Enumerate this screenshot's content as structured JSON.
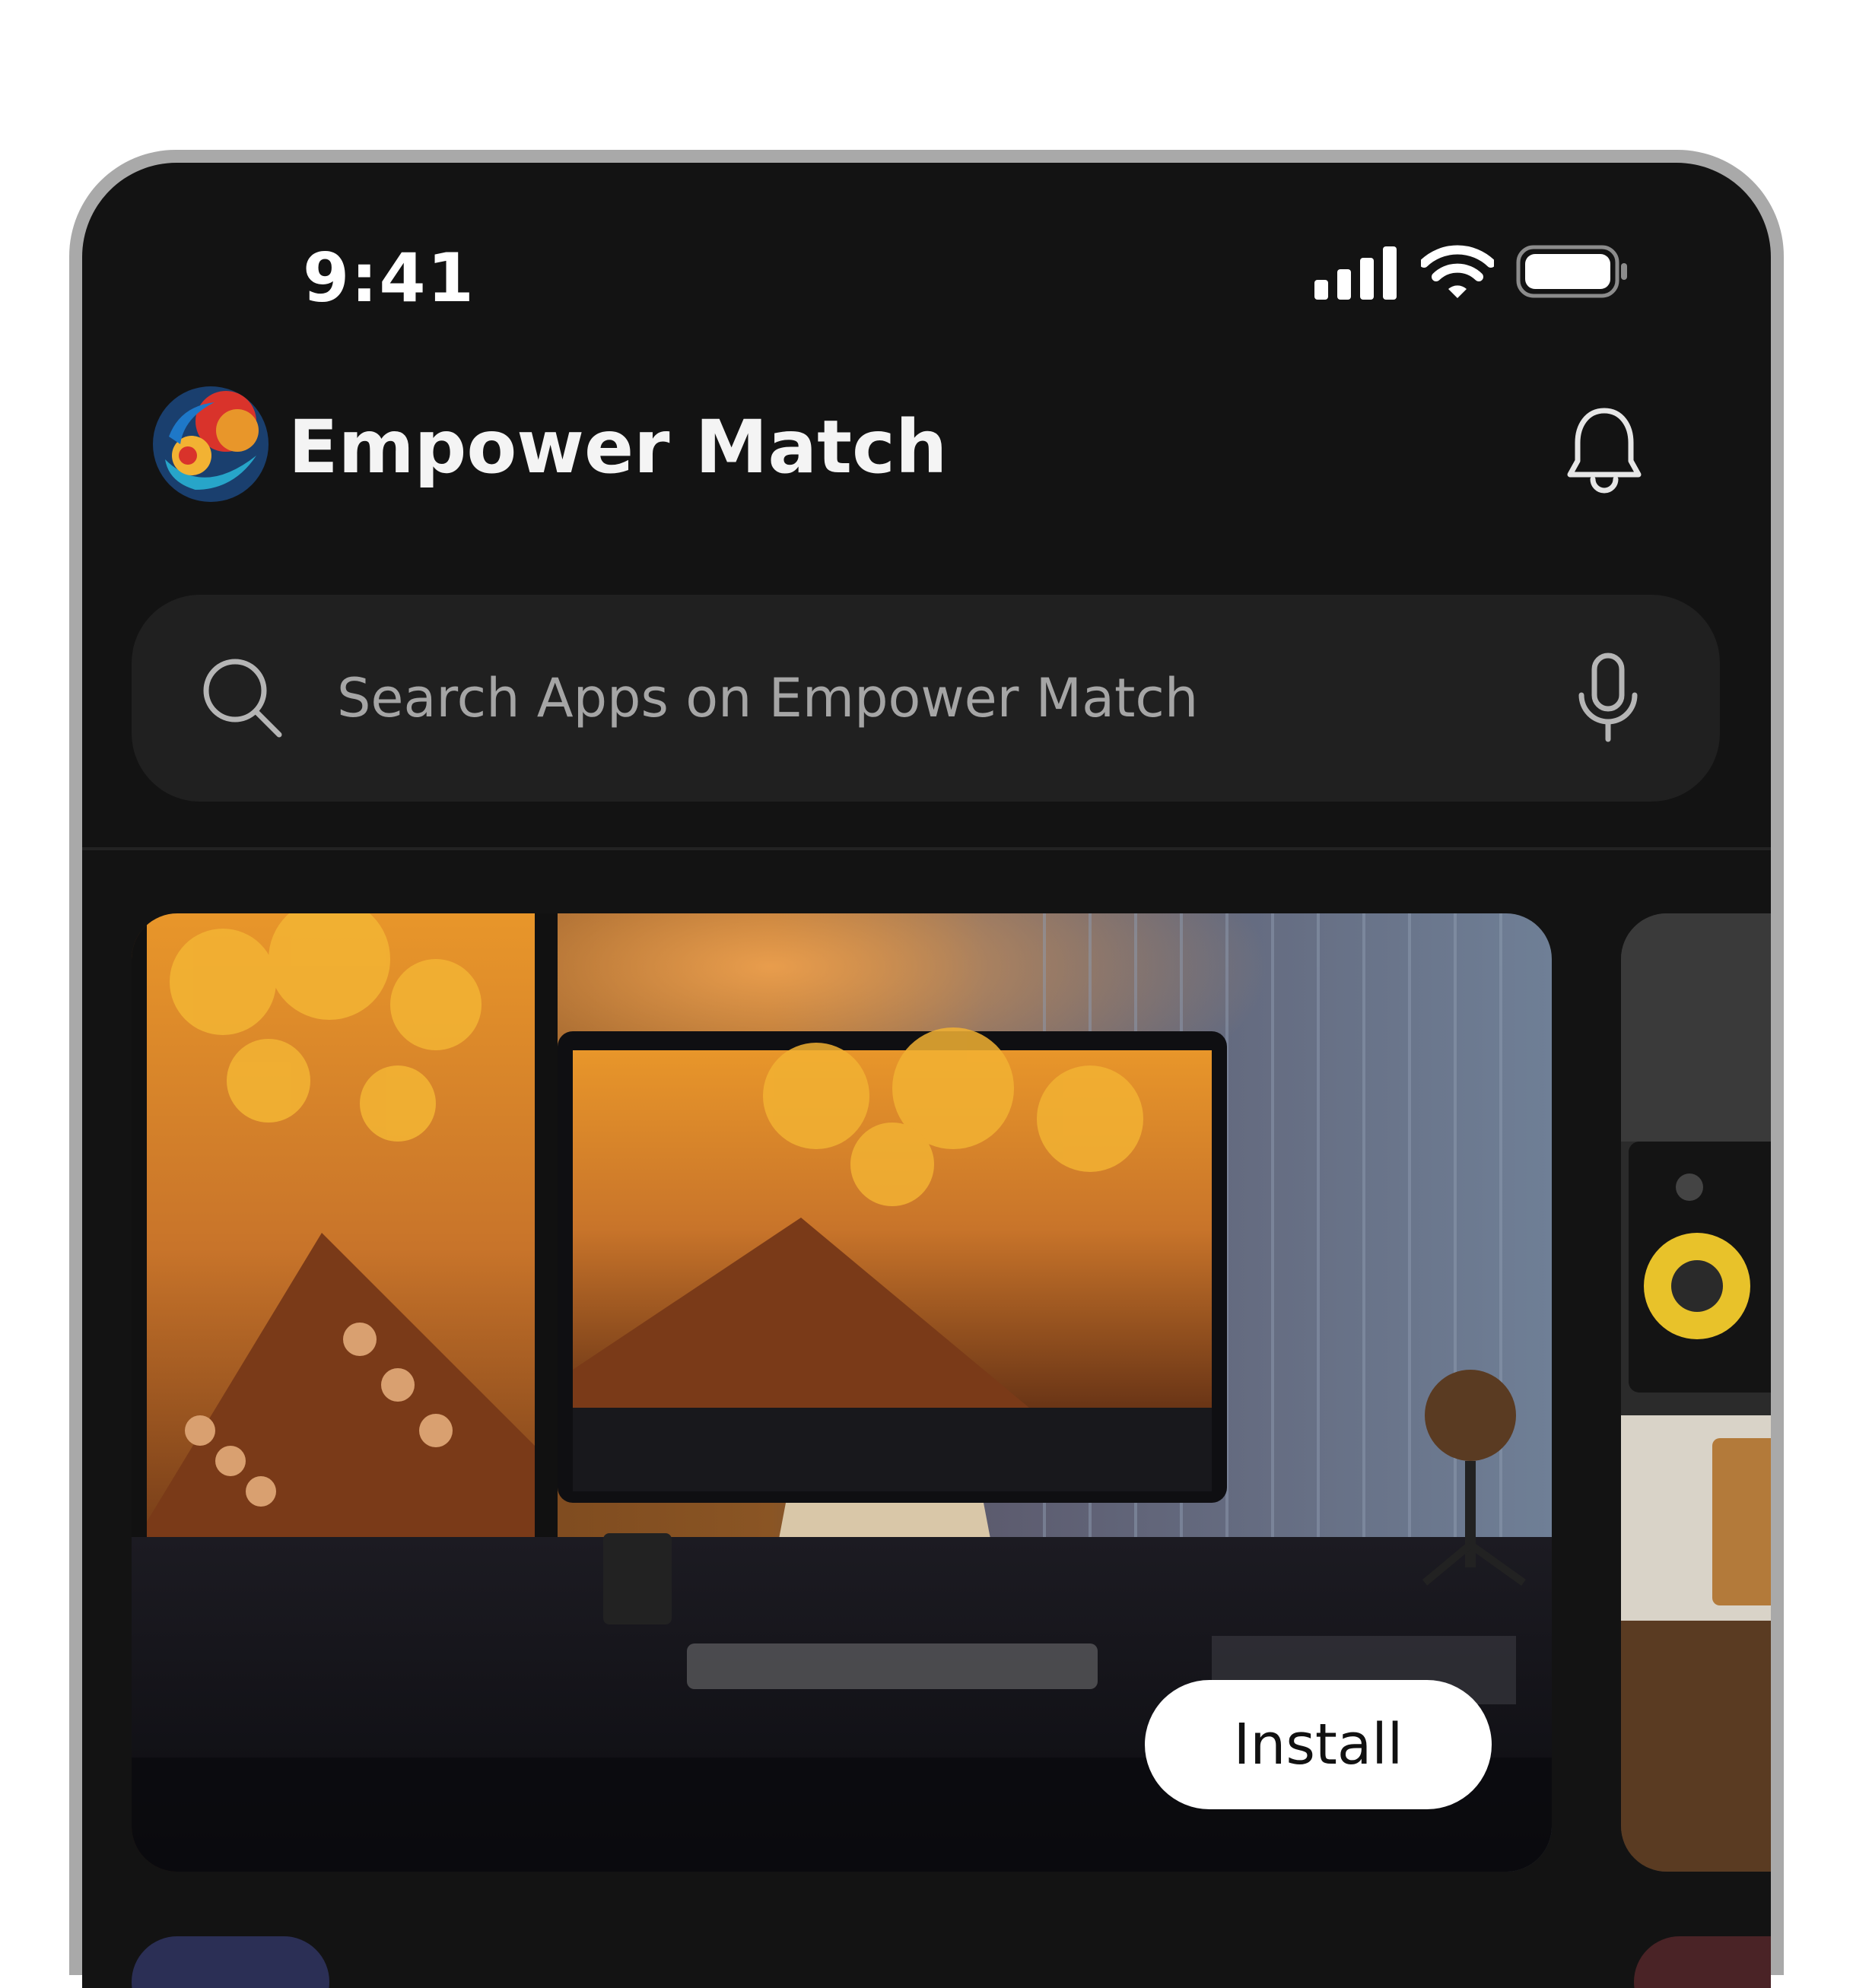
{
  "status_bar": {
    "time": "9:41"
  },
  "header": {
    "title": "Empower Match"
  },
  "search": {
    "placeholder": "Search Apps on Empower Match"
  },
  "featured": {
    "install_label": "Install"
  },
  "colors": {
    "background": "#131313",
    "search_bg": "#202020",
    "button_bg": "#ffffff",
    "accent_orange": "#e8962a"
  },
  "icons": [
    "cellular-signal-icon",
    "wifi-icon",
    "battery-icon",
    "app-logo-icon",
    "bell-icon",
    "search-icon",
    "microphone-icon"
  ]
}
